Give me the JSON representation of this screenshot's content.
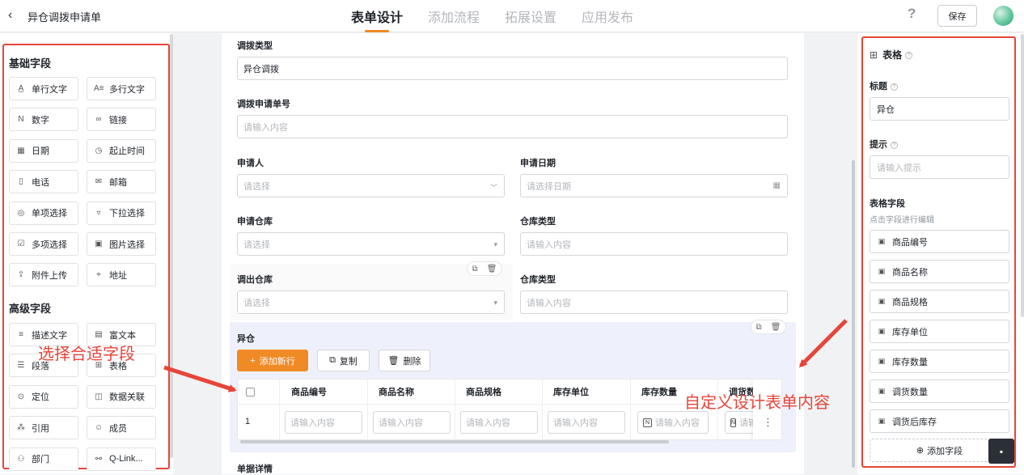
{
  "header": {
    "title": "异仓调拨申请单",
    "tabs": [
      "表单设计",
      "添加流程",
      "拓展设置",
      "应用发布"
    ],
    "active_tab": 0,
    "help_glyph": "?",
    "save_label": "保存"
  },
  "left_panel": {
    "basic_title": "基础字段",
    "basic_fields": [
      {
        "icon": "single-line-text-icon",
        "glyph": "A̲",
        "label": "单行文字"
      },
      {
        "icon": "multi-line-text-icon",
        "glyph": "A≡",
        "label": "多行文字"
      },
      {
        "icon": "number-icon",
        "glyph": "N",
        "label": "数字"
      },
      {
        "icon": "link-icon",
        "glyph": "∞",
        "label": "链接"
      },
      {
        "icon": "date-icon",
        "glyph": "▦",
        "label": "日期"
      },
      {
        "icon": "time-range-icon",
        "glyph": "◷",
        "label": "起止时间"
      },
      {
        "icon": "phone-icon",
        "glyph": "▯",
        "label": "电话"
      },
      {
        "icon": "mail-icon",
        "glyph": "✉",
        "label": "邮箱"
      },
      {
        "icon": "radio-icon",
        "glyph": "◎",
        "label": "单项选择"
      },
      {
        "icon": "dropdown-icon",
        "glyph": "▿",
        "label": "下拉选择"
      },
      {
        "icon": "checkbox-icon",
        "glyph": "☑",
        "label": "多项选择"
      },
      {
        "icon": "image-icon",
        "glyph": "▣",
        "label": "图片选择"
      },
      {
        "icon": "upload-icon",
        "glyph": "⇪",
        "label": "附件上传"
      },
      {
        "icon": "address-icon",
        "glyph": "⌖",
        "label": "地址"
      }
    ],
    "advanced_title": "高级字段",
    "advanced_fields": [
      {
        "icon": "description-icon",
        "glyph": "≡",
        "label": "描述文字"
      },
      {
        "icon": "rich-text-icon",
        "glyph": "▤",
        "label": "富文本"
      },
      {
        "icon": "paragraph-icon",
        "glyph": "☰",
        "label": "段落"
      },
      {
        "icon": "table-icon",
        "glyph": "⊞",
        "label": "表格"
      },
      {
        "icon": "location-icon",
        "glyph": "⊙",
        "label": "定位"
      },
      {
        "icon": "data-link-icon",
        "glyph": "◫",
        "label": "数据关联"
      },
      {
        "icon": "reference-icon",
        "glyph": "⁂",
        "label": "引用"
      },
      {
        "icon": "member-icon",
        "glyph": "☺",
        "label": "成员"
      },
      {
        "icon": "department-icon",
        "glyph": "⚇",
        "label": "部门"
      },
      {
        "icon": "q-link-icon",
        "glyph": "⚯",
        "label": "Q-Link..."
      }
    ]
  },
  "form": {
    "transfer_type": {
      "label": "调拨类型",
      "value": "异仓调拨"
    },
    "request_no": {
      "label": "调拨申请单号",
      "placeholder": "请输入内容"
    },
    "applicant": {
      "label": "申请人",
      "placeholder": "请选择"
    },
    "apply_date": {
      "label": "申请日期",
      "placeholder": "请选择日期"
    },
    "apply_warehouse": {
      "label": "申请仓库",
      "placeholder": "请选择"
    },
    "warehouse_type_1": {
      "label": "仓库类型",
      "placeholder": "请输入内容"
    },
    "out_warehouse": {
      "label": "调出仓库",
      "placeholder": "请选择"
    },
    "warehouse_type_2": {
      "label": "仓库类型",
      "placeholder": "请输入内容"
    },
    "next_section_label": "单据详情"
  },
  "table_block": {
    "title": "异仓",
    "add_row": "添加新行",
    "copy": "复制",
    "delete": "删除",
    "columns": [
      "商品编号",
      "商品名称",
      "商品规格",
      "库存单位",
      "库存数量",
      "调货数"
    ],
    "row_index": "1",
    "cell_placeholder": "请输入内容",
    "more_glyph": "⋮"
  },
  "right_panel": {
    "title": "表格",
    "title_label": "标题",
    "title_value": "异仓",
    "hint_label": "提示",
    "hint_placeholder": "请输入提示",
    "fields_label": "表格字段",
    "fields_sub": "点击字段进行编辑",
    "fields": [
      "商品编号",
      "商品名称",
      "商品规格",
      "库存单位",
      "库存数量",
      "调货数量",
      "调货后库存"
    ],
    "add_field": "添加字段"
  },
  "annotations": {
    "left": "选择合适字段",
    "right": "自定义设计表单内容"
  },
  "colors": {
    "accent": "#f08a24",
    "annotation_red": "#e6453a",
    "table_bg": "#eef1fb"
  }
}
